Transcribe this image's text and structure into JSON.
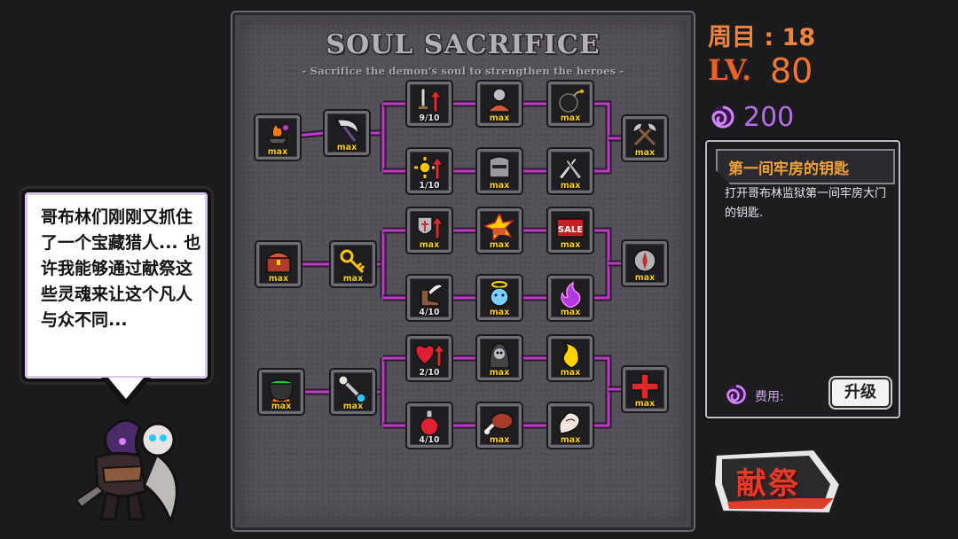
{
  "board": {
    "title": "SOUL SACRIFICE",
    "subtitle": "- Sacrifice the demon's soul to strengthen the heroes -"
  },
  "tree": {
    "line_color": "#c13ac7",
    "rows": [
      {
        "root": {
          "icon": "flaming-anvil-icon",
          "level": "max"
        },
        "second": {
          "icon": "scythe-blade-icon",
          "level": "max"
        },
        "top": [
          {
            "icon": "sword-attack-up-icon",
            "level": "9/10"
          },
          {
            "icon": "armored-knight-icon",
            "level": "max"
          },
          {
            "icon": "bomb-icon",
            "level": "max"
          }
        ],
        "bottom": [
          {
            "icon": "sun-gear-up-icon",
            "level": "1/10"
          },
          {
            "icon": "knight-helmet-icon",
            "level": "max"
          },
          {
            "icon": "twin-daggers-icon",
            "level": "max"
          }
        ],
        "end": {
          "icon": "crossed-axes-icon",
          "level": "max"
        }
      },
      {
        "root": {
          "icon": "treasure-chest-icon",
          "level": "max"
        },
        "second": {
          "icon": "golden-key-icon",
          "level": "max"
        },
        "top": [
          {
            "icon": "shield-defense-up-icon",
            "level": "max"
          },
          {
            "icon": "gold-explosion-icon",
            "level": "max"
          },
          {
            "icon": "sale-sign-icon",
            "level": "max"
          }
        ],
        "bottom": [
          {
            "icon": "winged-boot-icon",
            "level": "4/10"
          },
          {
            "icon": "angel-halo-icon",
            "level": "max"
          },
          {
            "icon": "purple-flame-icon",
            "level": "max"
          }
        ],
        "end": {
          "icon": "compass-icon",
          "level": "max"
        }
      },
      {
        "root": {
          "icon": "cauldron-icon",
          "level": "max"
        },
        "second": {
          "icon": "skull-staff-icon",
          "level": "max"
        },
        "top": [
          {
            "icon": "heart-health-up-icon",
            "level": "2/10"
          },
          {
            "icon": "hooded-reaper-icon",
            "level": "max"
          },
          {
            "icon": "yellow-spirit-icon",
            "level": "max"
          }
        ],
        "bottom": [
          {
            "icon": "red-potion-icon",
            "level": "4/10"
          },
          {
            "icon": "meat-icon",
            "level": "max"
          },
          {
            "icon": "flexed-arm-icon",
            "level": "max"
          }
        ],
        "end": {
          "icon": "red-cross-icon",
          "level": "max"
        }
      }
    ]
  },
  "stats": {
    "cycle": "周目 : 18",
    "level_label": "LV.",
    "level_value": "80",
    "souls": "200"
  },
  "info": {
    "title": "第一间牢房的钥匙",
    "description": "打开哥布林监狱第一间牢房大门的钥匙.",
    "cost_label": "费用:",
    "upgrade": "升级"
  },
  "sacrifice_button": "献祭",
  "dialog": {
    "text": "哥布林们刚刚又抓住了一个宝藏猎人... 也许我能够通过献祭这些灵魂来让这个凡人与众不同..."
  },
  "colors": {
    "accent_orange": "#f0843c",
    "soul_purple": "#b76ee8",
    "max_yellow": "#ffd400",
    "sacrifice_red": "#e43a2a"
  }
}
